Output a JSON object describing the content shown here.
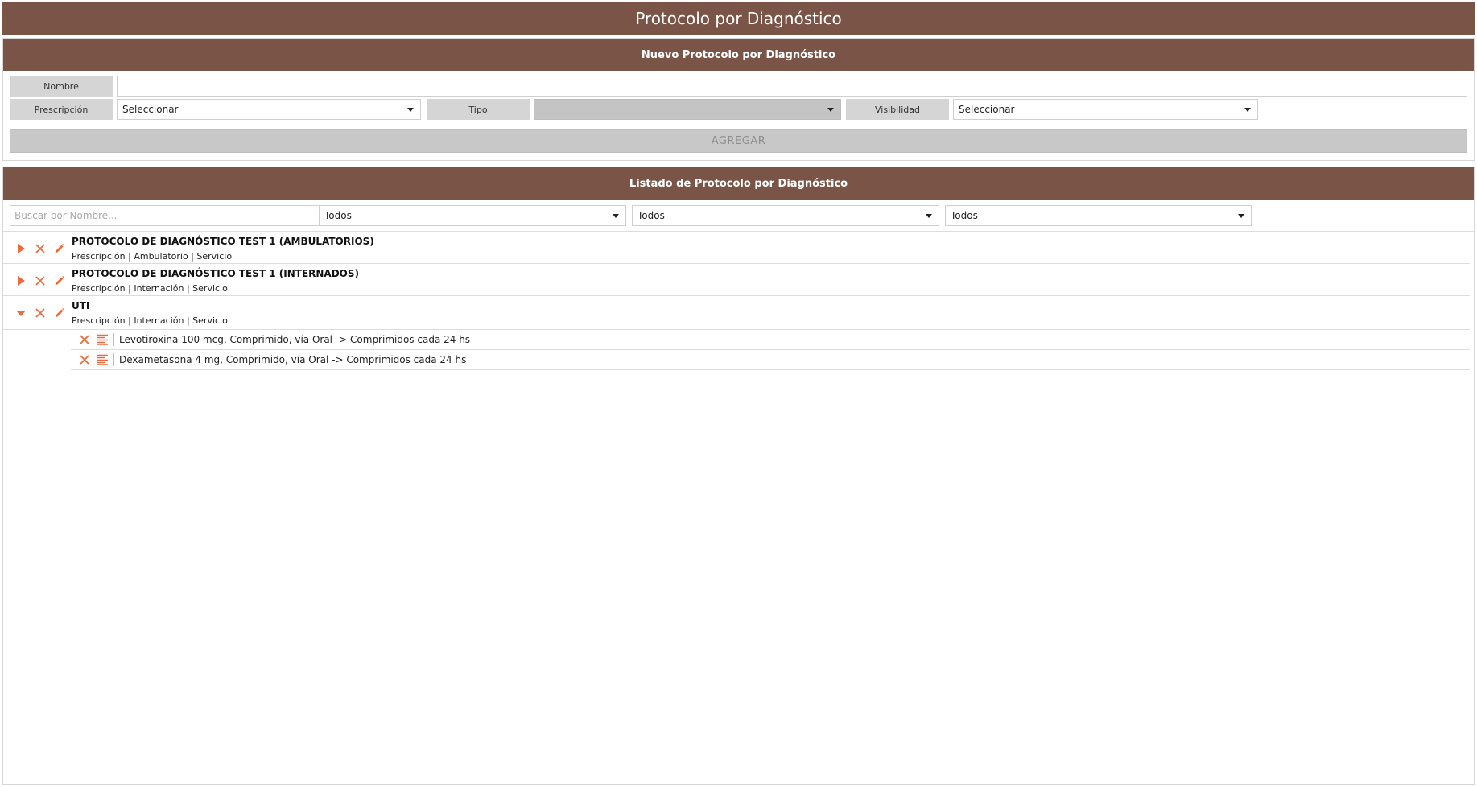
{
  "page": {
    "title": "Protocolo por Diagnóstico"
  },
  "colors": {
    "header_brown": "#7a5547",
    "accent_orange": "#f0693c",
    "label_gray": "#d5d5d5"
  },
  "new_form": {
    "header": "Nuevo Protocolo por Diagnóstico",
    "nombre_label": "Nombre",
    "nombre_value": "",
    "prescripcion_label": "Prescripción",
    "prescripcion_value": "Seleccionar",
    "tipo_label": "Tipo",
    "tipo_value": "",
    "visibilidad_label": "Visibilidad",
    "visibilidad_value": "Seleccionar",
    "add_button": "AGREGAR"
  },
  "list": {
    "header": "Listado de Protocolo por Diagnóstico",
    "search_placeholder": "Buscar por Nombre...",
    "filters": [
      "Todos",
      "Todos",
      "Todos"
    ],
    "items": [
      {
        "name": "PROTOCOLO DE DIAGNÓSTICO TEST 1 (AMBULATORIOS)",
        "meta": "Prescripción | Ambulatorio | Servicio",
        "expanded": false
      },
      {
        "name": "PROTOCOLO DE DIAGNÓSTICO TEST 1 (INTERNADOS)",
        "meta": "Prescripción | Internación | Servicio",
        "expanded": false
      },
      {
        "name": "UTI",
        "meta": "Prescripción | Internación | Servicio",
        "expanded": true,
        "children": [
          "Levotiroxina 100 mcg, Comprimido, vía Oral -> Comprimidos cada 24 hs",
          "Dexametasona 4 mg, Comprimido, vía Oral -> Comprimidos cada 24 hs"
        ]
      }
    ]
  },
  "icons": [
    "play-icon",
    "caret-down-icon",
    "close-icon",
    "pencil-icon",
    "list-icon"
  ]
}
